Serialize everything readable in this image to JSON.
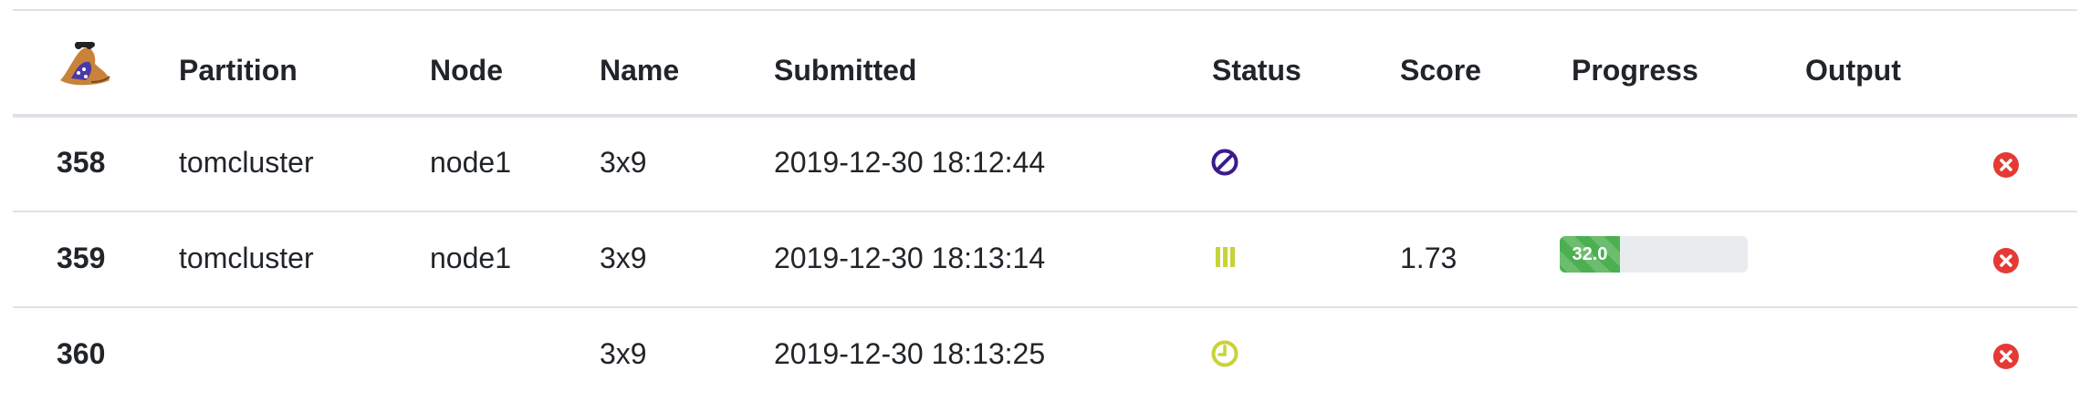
{
  "headers": {
    "partition": "Partition",
    "node": "Node",
    "name": "Name",
    "submitted": "Submitted",
    "status": "Status",
    "score": "Score",
    "progress": "Progress",
    "output": "Output"
  },
  "colors": {
    "cancelled": "#3a1a8c",
    "running": "#c8d33a",
    "pending": "#c8d33a",
    "cancel_button": "#e53935",
    "progress_bar": "#4caf50"
  },
  "jobs": [
    {
      "id": "358",
      "partition": "tomcluster",
      "node": "node1",
      "name": "3x9",
      "submitted": "2019-12-30 18:12:44",
      "status_icon": "ban-icon",
      "score": "",
      "progress": null,
      "output": ""
    },
    {
      "id": "359",
      "partition": "tomcluster",
      "node": "node1",
      "name": "3x9",
      "submitted": "2019-12-30 18:13:14",
      "status_icon": "running-bars-icon",
      "score": "1.73",
      "progress": {
        "label": "32.0",
        "percent": 32
      },
      "output": ""
    },
    {
      "id": "360",
      "partition": "",
      "node": "",
      "name": "3x9",
      "submitted": "2019-12-30 18:13:25",
      "status_icon": "clock-icon",
      "score": "",
      "progress": null,
      "output": ""
    }
  ]
}
